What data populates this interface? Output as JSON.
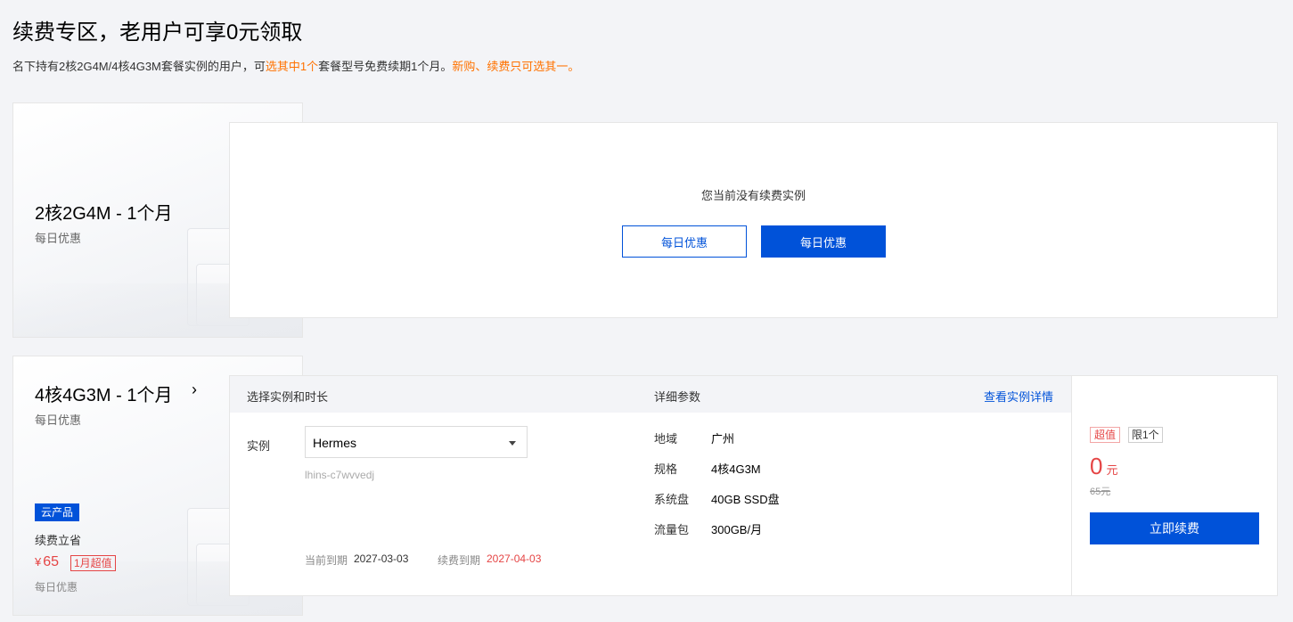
{
  "header": {
    "title": "续费专区，老用户可享0元领取",
    "desc_part1": "名下持有2核2G4M/4核4G3M套餐实例的用户，可",
    "desc_highlight1": "选其中1个",
    "desc_part2": "套餐型号免费续期1个月。",
    "desc_highlight2": "新购、续费只可选其一。"
  },
  "card1": {
    "title": "2核2G4M - 1个月",
    "subtitle": "每日优惠"
  },
  "panel1": {
    "empty_text": "您当前没有续费实例",
    "btn_outline_label": "每日优惠",
    "btn_solid_label": "每日优惠"
  },
  "card2": {
    "title": "4核4G3M - 1个月",
    "subtitle": "每日优惠",
    "chevron_icon": "chevron-right-icon",
    "tag": "云产品",
    "renew_label": "续费立省",
    "price_symbol": "¥",
    "price_value": "65",
    "badge": "1月超值",
    "footer": "每日优惠"
  },
  "panel2": {
    "head_left": "选择实例和时长",
    "head_mid": "详细参数",
    "head_link": "查看实例详情",
    "instance_label": "实例",
    "instance_value": "Hermes",
    "instance_id": "lhins-c7wvvedj",
    "current_expire_label": "当前到期",
    "current_expire_value": "2027-03-03",
    "renew_expire_label": "续费到期",
    "renew_expire_value": "2027-04-03",
    "params": [
      {
        "label": "地域",
        "value": "广州"
      },
      {
        "label": "规格",
        "value": "4核4G3M"
      },
      {
        "label": "系统盘",
        "value": "40GB SSD盘"
      },
      {
        "label": "流量包",
        "value": "300GB/月"
      }
    ]
  },
  "panel3": {
    "tag_super": "超值",
    "tag_limit": "限1个",
    "price": "0",
    "unit": "元",
    "original_price": "65元",
    "btn_label": "立即续费"
  },
  "colors": {
    "primary": "#0052d9",
    "accent_orange": "#ff7200",
    "price_red": "#e54545"
  }
}
